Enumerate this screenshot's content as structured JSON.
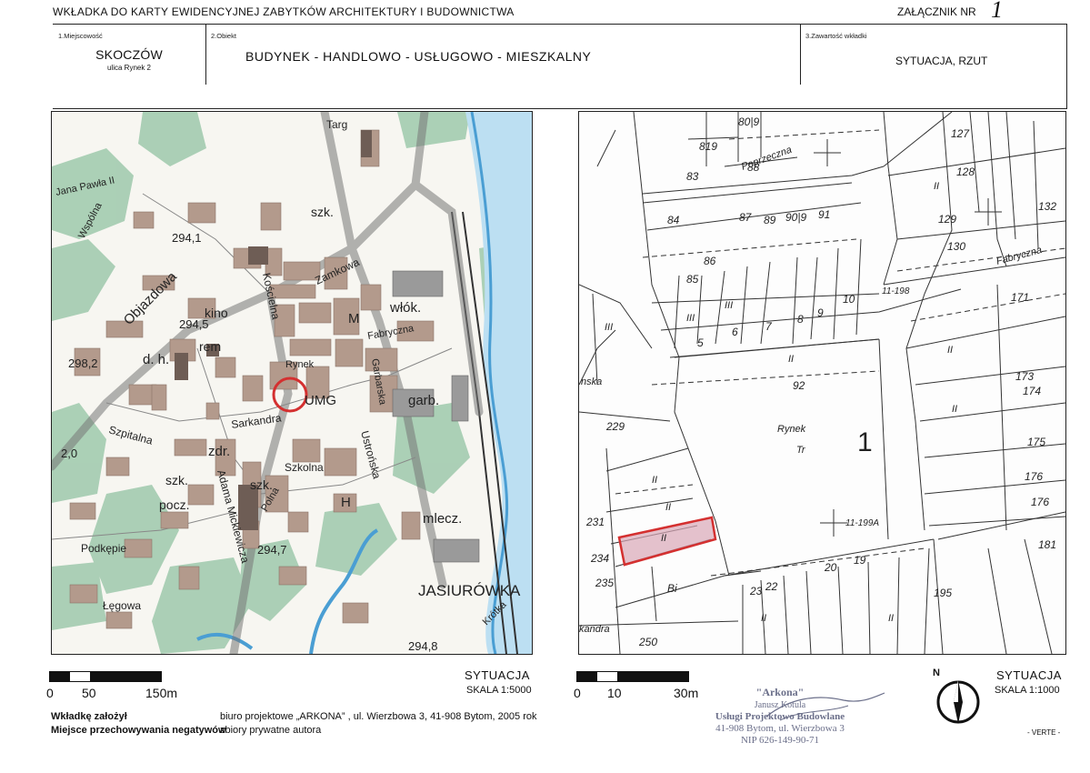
{
  "header": {
    "title": "WKŁADKA DO KARTY EWIDENCYJNEJ ZABYTKÓW ARCHITEKTURY I BUDOWNICTWA",
    "attachment_label": "ZAŁĄCZNIK NR",
    "attachment_number": "1"
  },
  "fields": {
    "place_label": "1.Miejscowość",
    "place": "SKOCZÓW",
    "street": "ulica Rynek 2",
    "object_label": "2.Obiekt",
    "object": "BUDYNEK - HANDLOWO - USŁUGOWO - MIESZKALNY",
    "content_label": "3.Zawartość wkładki",
    "content": "SYTUACJA, RZUT"
  },
  "left_map": {
    "labels": {
      "targ": "Targ",
      "pawla": "Jana Pawła II",
      "wspolna": "Wspólna",
      "h2941": "294,1",
      "objazdowa": "Objazdowa",
      "szk1": "szk.",
      "zamkowa": "Zamkowa",
      "wlok": "włók.",
      "kino": "kino",
      "koscielna": "Kościelna",
      "h2945": "294,5",
      "rem": "rem",
      "M": "M",
      "fabryczna": "Fabryczna",
      "h2982": "298,2",
      "dh": "d. h.",
      "rynek": "Rynek",
      "umg": "UMG",
      "garbarska": "Garbarska",
      "garb": "garb.",
      "szpitalna": "Szpitalna",
      "sarkandra": "Sarkandra",
      "h20": "2,0",
      "zdr": "zdr.",
      "ustronska": "Ustrońska",
      "szk2": "szk.",
      "szk3": "szk.",
      "szkolna": "Szkolna",
      "pocz": "pocz.",
      "H": "H",
      "mickiewicza": "Adama Mickiewicza",
      "polna": "Polna",
      "mlecz": "mlecz.",
      "podkepie": "Podkępie",
      "h2947": "294,7",
      "legowa": "Łęgowa",
      "jasiurowka": "JASIURÓWKA",
      "krotka": "Krótka",
      "h2948": "294,8"
    },
    "scale_title": "SYTUACJA",
    "scale_value": "SKALA 1:5000",
    "ticks": [
      "0",
      "50",
      "150m"
    ]
  },
  "right_map": {
    "labels": {
      "l819": "819",
      "l809": "80|9",
      "poprzeczna": "Poprzeczna",
      "l83": "83",
      "l88": "88",
      "l84": "84",
      "l87": "87",
      "l89": "89",
      "l90": "90|9",
      "l91": "91",
      "l86": "86",
      "l85": "85",
      "l127": "127",
      "l128": "128",
      "l129": "129",
      "l130": "130",
      "l132": "132",
      "fabryczna": "Fabryczna",
      "l198": "11-198",
      "l171": "171",
      "l173": "173",
      "l174": "174",
      "l175": "175",
      "l176a": "176",
      "l176b": "176",
      "l92": "92",
      "rynek": "Rynek",
      "tr": "Tr",
      "big1": "1",
      "l229": "229",
      "nska": "nska",
      "l199a": "11-199A",
      "l231": "231",
      "l234": "234",
      "l235": "235",
      "bi": "Bi",
      "kandra": "kandra",
      "l250": "250",
      "l5": "5",
      "l6": "6",
      "l7": "7",
      "l8": "8",
      "l9": "9",
      "l10": "10",
      "l20": "20",
      "l19": "19",
      "l23": "23",
      "l22": "22",
      "l195": "195",
      "II": "II",
      "III": "III",
      "l181": "181"
    },
    "scale_title": "SYTUACJA",
    "scale_value": "SKALA 1:1000",
    "ticks": [
      "0",
      "10",
      "30m"
    ],
    "north": "N"
  },
  "footer": {
    "founder_label": "Wkładkę założył",
    "founder_value": "biuro projektowe „ARKONA” , ul. Wierzbowa 3, 41-908 Bytom, 2005 rok",
    "storage_label": "Miejsce przechowywania negatywów",
    "storage_value": "zbiory prywatne autora",
    "verte": "- VERTE -"
  },
  "stamp": {
    "line1": "\"Arkona\"",
    "line2": "Janusz Kotula",
    "line3": "Usługi Projektowo Budowlane",
    "line4": "41-908 Bytom, ul. Wierzbowa 3",
    "line5": "NIP 626-149-90-71"
  },
  "colors": {
    "building": "#b39a8c",
    "green": "#8cbfa0",
    "water": "#4a9ed3",
    "highlight": "#d43030",
    "stamp": "#6b6f8a"
  }
}
